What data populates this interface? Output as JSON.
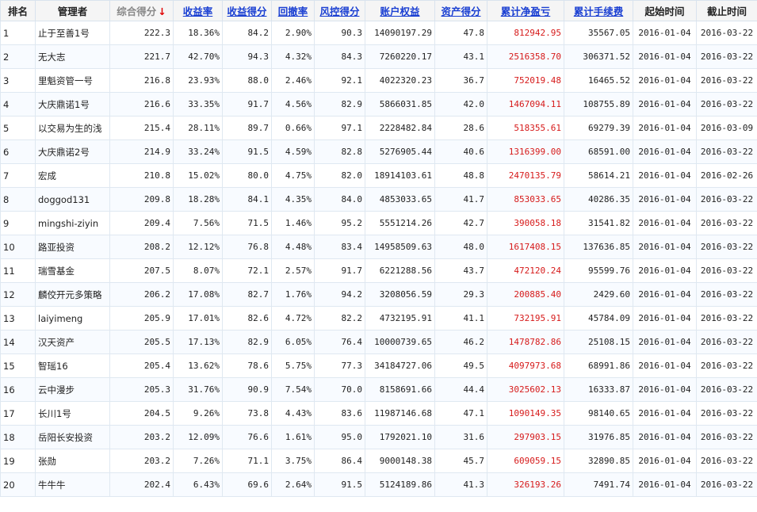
{
  "headers": [
    {
      "label": "排名",
      "style": "plain",
      "sortable": false
    },
    {
      "label": "管理者",
      "style": "plain",
      "sortable": false
    },
    {
      "label": "综合得分",
      "style": "sorted",
      "sortable": true,
      "arrow": "↓"
    },
    {
      "label": "收益率",
      "style": "link",
      "sortable": true
    },
    {
      "label": "收益得分",
      "style": "link",
      "sortable": true
    },
    {
      "label": "回撤率",
      "style": "link",
      "sortable": true
    },
    {
      "label": "风控得分",
      "style": "link",
      "sortable": true
    },
    {
      "label": "账户权益",
      "style": "link",
      "sortable": true
    },
    {
      "label": "资产得分",
      "style": "link",
      "sortable": true
    },
    {
      "label": "累计净盈亏",
      "style": "link",
      "sortable": true
    },
    {
      "label": "累计手续费",
      "style": "link",
      "sortable": true
    },
    {
      "label": "起始时间",
      "style": "plain",
      "sortable": false
    },
    {
      "label": "截止时间",
      "style": "plain",
      "sortable": false
    }
  ],
  "colors": {
    "header_link": "#1a3fd2",
    "profit_red": "#d61a1a",
    "sort_arrow": "#e00000",
    "grid": "#dfe8f1"
  },
  "rows": [
    [
      "1",
      "止于至善1号",
      "222.3",
      "18.36%",
      "84.2",
      "2.90%",
      "90.3",
      "14090197.29",
      "47.8",
      "812942.95",
      "35567.05",
      "2016-01-04",
      "2016-03-22"
    ],
    [
      "2",
      "无大志",
      "221.7",
      "42.70%",
      "94.3",
      "4.32%",
      "84.3",
      "7260220.17",
      "43.1",
      "2516358.70",
      "306371.52",
      "2016-01-04",
      "2016-03-22"
    ],
    [
      "3",
      "里魁资管一号",
      "216.8",
      "23.93%",
      "88.0",
      "2.46%",
      "92.1",
      "4022320.23",
      "36.7",
      "752019.48",
      "16465.52",
      "2016-01-04",
      "2016-03-22"
    ],
    [
      "4",
      "大庆鼎诺1号",
      "216.6",
      "33.35%",
      "91.7",
      "4.56%",
      "82.9",
      "5866031.85",
      "42.0",
      "1467094.11",
      "108755.89",
      "2016-01-04",
      "2016-03-22"
    ],
    [
      "5",
      "以交易为生的浅",
      "215.4",
      "28.11%",
      "89.7",
      "0.66%",
      "97.1",
      "2228482.84",
      "28.6",
      "518355.61",
      "69279.39",
      "2016-01-04",
      "2016-03-09"
    ],
    [
      "6",
      "大庆鼎诺2号",
      "214.9",
      "33.24%",
      "91.5",
      "4.59%",
      "82.8",
      "5276905.44",
      "40.6",
      "1316399.00",
      "68591.00",
      "2016-01-04",
      "2016-03-22"
    ],
    [
      "7",
      "宏成",
      "210.8",
      "15.02%",
      "80.0",
      "4.75%",
      "82.0",
      "18914103.61",
      "48.8",
      "2470135.79",
      "58614.21",
      "2016-01-04",
      "2016-02-26"
    ],
    [
      "8",
      "doggod131",
      "209.8",
      "18.28%",
      "84.1",
      "4.35%",
      "84.0",
      "4853033.65",
      "41.7",
      "853033.65",
      "40286.35",
      "2016-01-04",
      "2016-03-22"
    ],
    [
      "9",
      "mingshi-ziyin",
      "209.4",
      "7.56%",
      "71.5",
      "1.46%",
      "95.2",
      "5551214.26",
      "42.7",
      "390058.18",
      "31541.82",
      "2016-01-04",
      "2016-03-22"
    ],
    [
      "10",
      "路亚投资",
      "208.2",
      "12.12%",
      "76.8",
      "4.48%",
      "83.4",
      "14958509.63",
      "48.0",
      "1617408.15",
      "137636.85",
      "2016-01-04",
      "2016-03-22"
    ],
    [
      "11",
      "瑞雪基金",
      "207.5",
      "8.07%",
      "72.1",
      "2.57%",
      "91.7",
      "6221288.56",
      "43.7",
      "472120.24",
      "95599.76",
      "2016-01-04",
      "2016-03-22"
    ],
    [
      "12",
      "麟佼开元多策略",
      "206.2",
      "17.08%",
      "82.7",
      "1.76%",
      "94.2",
      "3208056.59",
      "29.3",
      "200885.40",
      "2429.60",
      "2016-01-04",
      "2016-03-22"
    ],
    [
      "13",
      "laiyimeng",
      "205.9",
      "17.01%",
      "82.6",
      "4.72%",
      "82.2",
      "4732195.91",
      "41.1",
      "732195.91",
      "45784.09",
      "2016-01-04",
      "2016-03-22"
    ],
    [
      "14",
      "汉天资产",
      "205.5",
      "17.13%",
      "82.9",
      "6.05%",
      "76.4",
      "10000739.65",
      "46.2",
      "1478782.86",
      "25108.15",
      "2016-01-04",
      "2016-03-22"
    ],
    [
      "15",
      "智瑶16",
      "205.4",
      "13.62%",
      "78.6",
      "5.75%",
      "77.3",
      "34184727.06",
      "49.5",
      "4097973.68",
      "68991.86",
      "2016-01-04",
      "2016-03-22"
    ],
    [
      "16",
      "云中漫步",
      "205.3",
      "31.76%",
      "90.9",
      "7.54%",
      "70.0",
      "8158691.66",
      "44.4",
      "3025602.13",
      "16333.87",
      "2016-01-04",
      "2016-03-22"
    ],
    [
      "17",
      "长川1号",
      "204.5",
      "9.26%",
      "73.8",
      "4.43%",
      "83.6",
      "11987146.68",
      "47.1",
      "1090149.35",
      "98140.65",
      "2016-01-04",
      "2016-03-22"
    ],
    [
      "18",
      "岳阳长安投资",
      "203.2",
      "12.09%",
      "76.6",
      "1.61%",
      "95.0",
      "1792021.10",
      "31.6",
      "297903.15",
      "31976.85",
      "2016-01-04",
      "2016-03-22"
    ],
    [
      "19",
      "张勋",
      "203.2",
      "7.26%",
      "71.1",
      "3.75%",
      "86.4",
      "9000148.38",
      "45.7",
      "609059.15",
      "32890.85",
      "2016-01-04",
      "2016-03-22"
    ],
    [
      "20",
      "牛牛牛",
      "202.4",
      "6.43%",
      "69.6",
      "2.64%",
      "91.5",
      "5124189.86",
      "41.3",
      "326193.26",
      "7491.74",
      "2016-01-04",
      "2016-03-22"
    ]
  ]
}
